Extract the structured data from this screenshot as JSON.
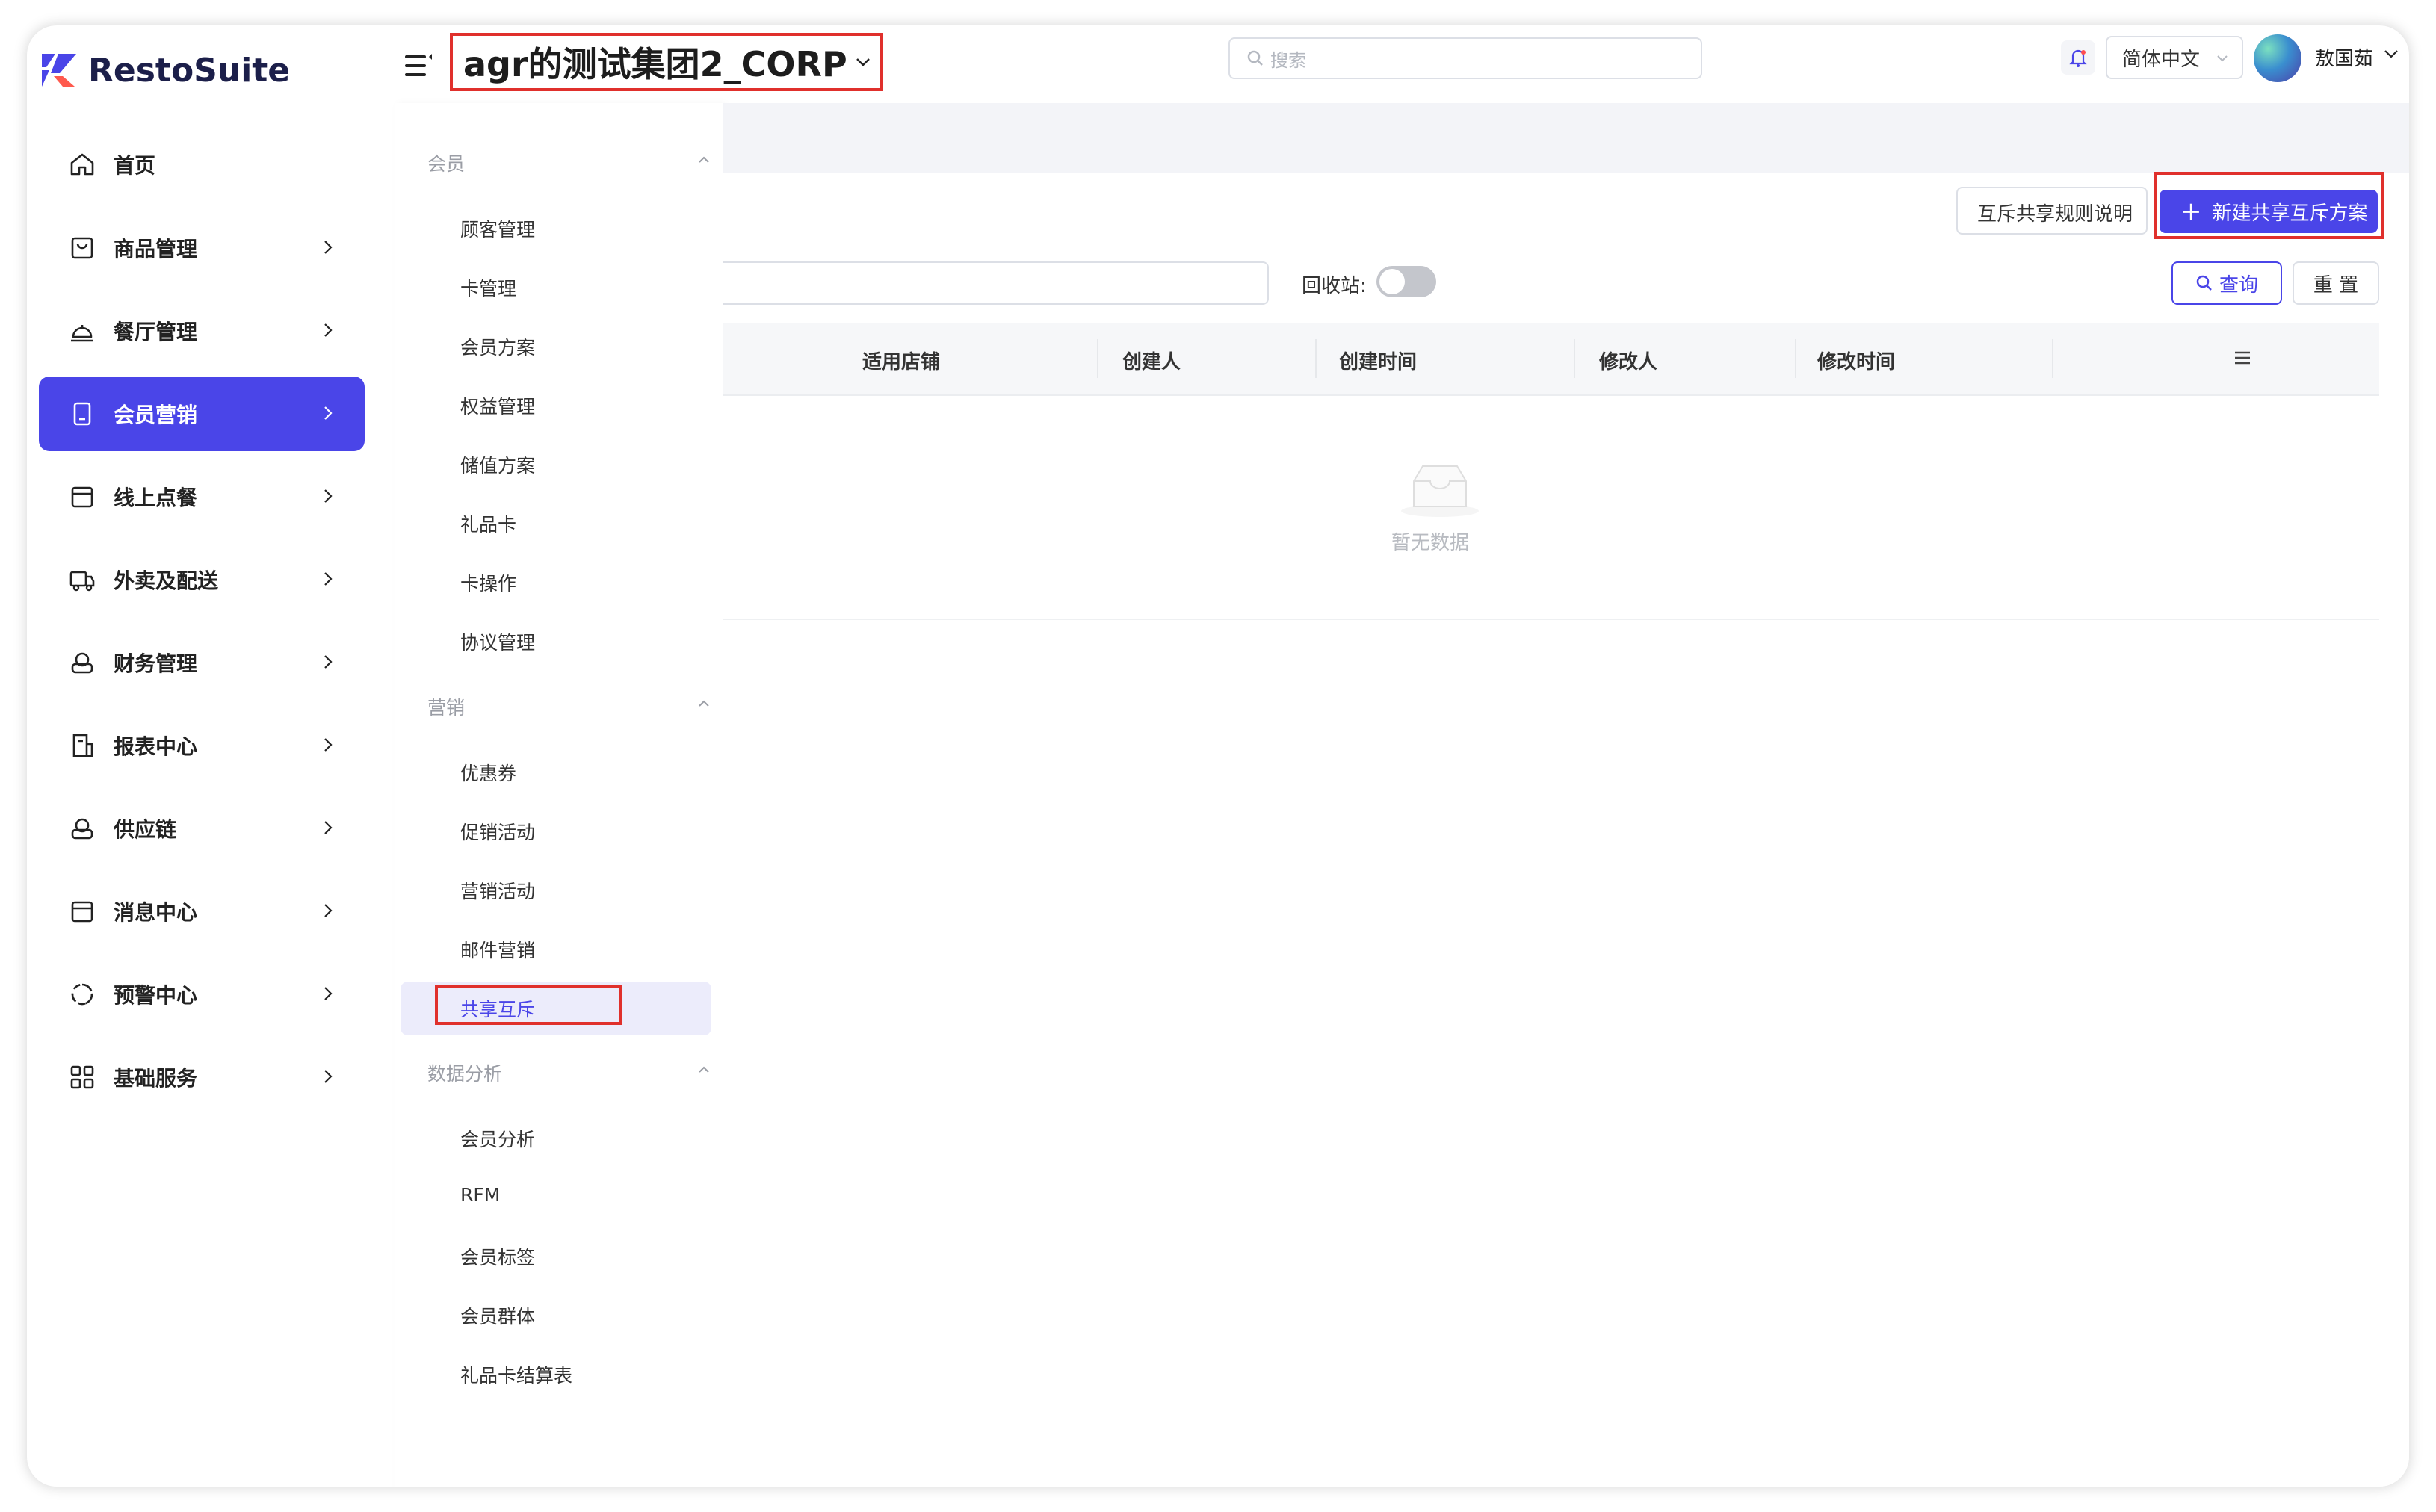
{
  "app": {
    "brand": "RestoSuite",
    "accent_color": "#4a45e8",
    "highlight_color": "#e0302c"
  },
  "header": {
    "org_name": "agr的测试集团2_CORP",
    "search_placeholder": "搜索",
    "language": "简体中文",
    "username": "敖国茹"
  },
  "sidebar": {
    "items": [
      {
        "label": "首页",
        "icon": "home-icon",
        "has_arrow": false
      },
      {
        "label": "商品管理",
        "icon": "product-bag-icon",
        "has_arrow": true
      },
      {
        "label": "餐厅管理",
        "icon": "restaurant-bell-icon",
        "has_arrow": true
      },
      {
        "label": "会员营销",
        "icon": "member-card-icon",
        "has_arrow": true,
        "active": true
      },
      {
        "label": "线上点餐",
        "icon": "online-order-icon",
        "has_arrow": true
      },
      {
        "label": "外卖及配送",
        "icon": "delivery-truck-icon",
        "has_arrow": true
      },
      {
        "label": "财务管理",
        "icon": "finance-icon",
        "has_arrow": true
      },
      {
        "label": "报表中心",
        "icon": "report-icon",
        "has_arrow": true
      },
      {
        "label": "供应链",
        "icon": "supply-chain-icon",
        "has_arrow": true
      },
      {
        "label": "消息中心",
        "icon": "message-icon",
        "has_arrow": true
      },
      {
        "label": "预警中心",
        "icon": "alert-icon",
        "has_arrow": true
      },
      {
        "label": "基础服务",
        "icon": "grid-icon",
        "has_arrow": true
      }
    ]
  },
  "submenu": {
    "sections": [
      {
        "title": "会员",
        "items": [
          "顾客管理",
          "卡管理",
          "会员方案",
          "权益管理",
          "储值方案",
          "礼品卡",
          "卡操作",
          "协议管理"
        ]
      },
      {
        "title": "营销",
        "items": [
          "优惠券",
          "促销活动",
          "营销活动",
          "邮件营销",
          "共享互斥"
        ]
      },
      {
        "title": "数据分析",
        "items": [
          "会员分析",
          "RFM",
          "会员标签",
          "会员群体",
          "礼品卡结算表"
        ]
      }
    ],
    "active_item": "共享互斥"
  },
  "toolbar": {
    "rule_button": "互斥共享规则说明",
    "new_button": "新建共享互斥方案",
    "recycle_label": "回收站:",
    "recycle_on": false,
    "query_button": "查询",
    "reset_button": "重 置"
  },
  "table": {
    "columns": [
      "适用店铺",
      "创建人",
      "创建时间",
      "修改人",
      "修改时间"
    ],
    "rows": [],
    "empty_text": "暂无数据"
  }
}
